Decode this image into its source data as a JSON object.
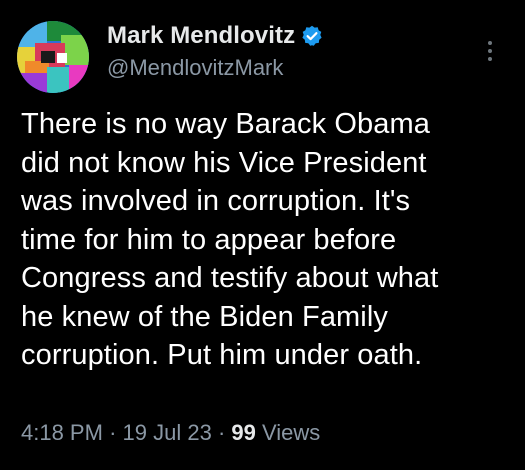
{
  "author": {
    "display_name": "Mark Mendlovitz",
    "handle": "@MendlovitzMark",
    "verified_icon": "verified-badge-icon",
    "avatar": "avatar-image"
  },
  "tweet": {
    "text": "There is no way Barack Obama\ndid not know his Vice President\nwas involved in corruption. It's\ntime for him to appear before\nCongress and testify about what\nhe knew of the Biden Family\ncorruption. Put him under oath."
  },
  "meta": {
    "time": "4:18 PM",
    "separator": "·",
    "date": "19 Jul 23",
    "views_count": "99",
    "views_label": "Views"
  },
  "menu": {
    "icon": "more-options-icon"
  },
  "colors": {
    "background": "#000000",
    "text": "#ffffff",
    "secondary": "#8b98a5",
    "verified": "#1d9bf0"
  }
}
